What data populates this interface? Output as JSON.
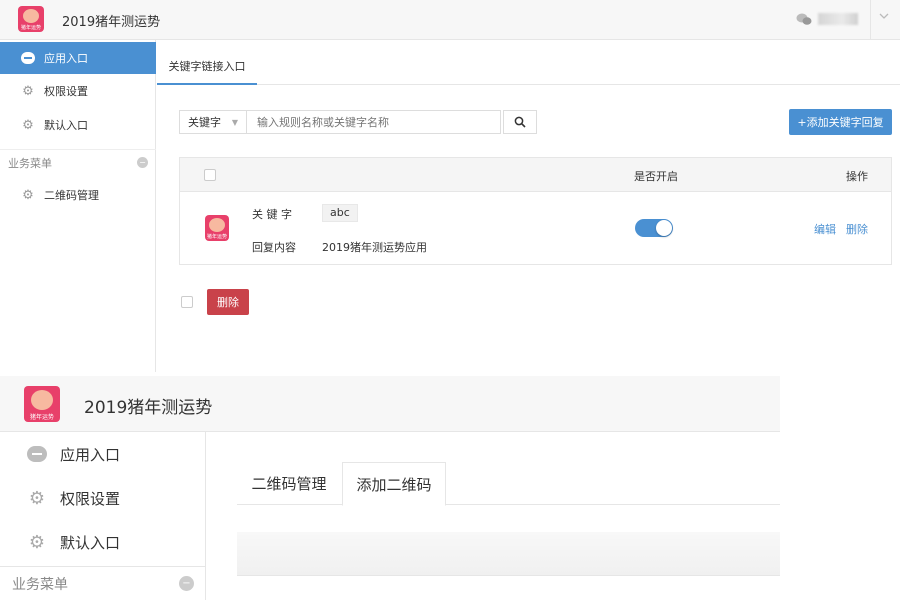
{
  "top": {
    "app_title": "2019猪年测运势",
    "logo_text": "猪年运势",
    "sidebar": {
      "items": [
        {
          "label": "应用入口",
          "icon": "chat-icon",
          "active": true
        },
        {
          "label": "权限设置",
          "icon": "gear-icon",
          "active": false
        },
        {
          "label": "默认入口",
          "icon": "gear-icon",
          "active": false
        }
      ],
      "group_label": "业务菜单",
      "group_items": [
        {
          "label": "二维码管理",
          "icon": "gear-icon"
        }
      ]
    },
    "tab": "关键字链接入口",
    "search": {
      "select_value": "关键字",
      "placeholder": "输入规则名称或关键字名称"
    },
    "add_button": "+添加关键字回复",
    "table": {
      "headers": {
        "enabled": "是否开启",
        "actions": "操作"
      },
      "rows": [
        {
          "keyword_label": "关 键 字",
          "keyword": "abc",
          "reply_label": "回复内容",
          "reply": "2019猪年测运势应用",
          "enabled": true,
          "edit": "编辑",
          "delete": "删除"
        }
      ]
    },
    "bulk_delete": "删除"
  },
  "bottom": {
    "app_title": "2019猪年测运势",
    "logo_text": "猪年运势",
    "sidebar": {
      "items": [
        {
          "label": "应用入口",
          "icon": "chat-icon"
        },
        {
          "label": "权限设置",
          "icon": "gear-icon"
        },
        {
          "label": "默认入口",
          "icon": "gear-icon"
        }
      ],
      "group_label": "业务菜单"
    },
    "tabs": [
      "二维码管理",
      "添加二维码"
    ],
    "active_tab": "添加二维码"
  },
  "colors": {
    "accent": "#4a90d2",
    "danger": "#c9424a",
    "logo": "#e8406a"
  }
}
